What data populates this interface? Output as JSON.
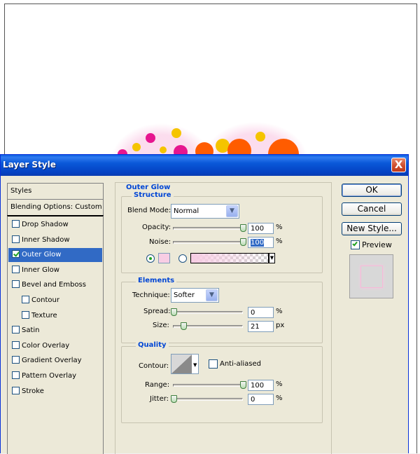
{
  "window": {
    "title": "Layer Style",
    "close_label": "X"
  },
  "styles_panel": {
    "header": "Styles",
    "blending_options": "Blending Options: Custom",
    "items": [
      {
        "label": "Drop Shadow",
        "checked": false
      },
      {
        "label": "Inner Shadow",
        "checked": false
      },
      {
        "label": "Outer Glow",
        "checked": true,
        "selected": true
      },
      {
        "label": "Inner Glow",
        "checked": false
      },
      {
        "label": "Bevel and Emboss",
        "checked": false
      },
      {
        "label": "Contour",
        "checked": false,
        "indent": true
      },
      {
        "label": "Texture",
        "checked": false,
        "indent": true
      },
      {
        "label": "Satin",
        "checked": false
      },
      {
        "label": "Color Overlay",
        "checked": false
      },
      {
        "label": "Gradient Overlay",
        "checked": false
      },
      {
        "label": "Pattern Overlay",
        "checked": false
      },
      {
        "label": "Stroke",
        "checked": false
      }
    ]
  },
  "outer_glow": {
    "title": "Outer Glow",
    "structure": {
      "title": "Structure",
      "blend_mode_label": "Blend Mode:",
      "blend_mode_value": "Normal",
      "opacity_label": "Opacity:",
      "opacity_value": "100",
      "opacity_unit": "%",
      "noise_label": "Noise:",
      "noise_value": "100",
      "noise_unit": "%",
      "glow_color": "#f8cde4"
    },
    "elements": {
      "title": "Elements",
      "technique_label": "Technique:",
      "technique_value": "Softer",
      "spread_label": "Spread:",
      "spread_value": "0",
      "spread_unit": "%",
      "size_label": "Size:",
      "size_value": "21",
      "size_unit": "px"
    },
    "quality": {
      "title": "Quality",
      "contour_label": "Contour:",
      "anti_aliased_label": "Anti-aliased",
      "range_label": "Range:",
      "range_value": "100",
      "range_unit": "%",
      "jitter_label": "Jitter:",
      "jitter_value": "0",
      "jitter_unit": "%"
    }
  },
  "buttons": {
    "ok": "OK",
    "cancel": "Cancel",
    "new_style": "New Style...",
    "preview_label": "Preview"
  },
  "colors": {
    "title_bar": "#0a58d8",
    "dialog_bg": "#ece9d8",
    "selection": "#316ac5",
    "group_title": "#0046d5"
  }
}
